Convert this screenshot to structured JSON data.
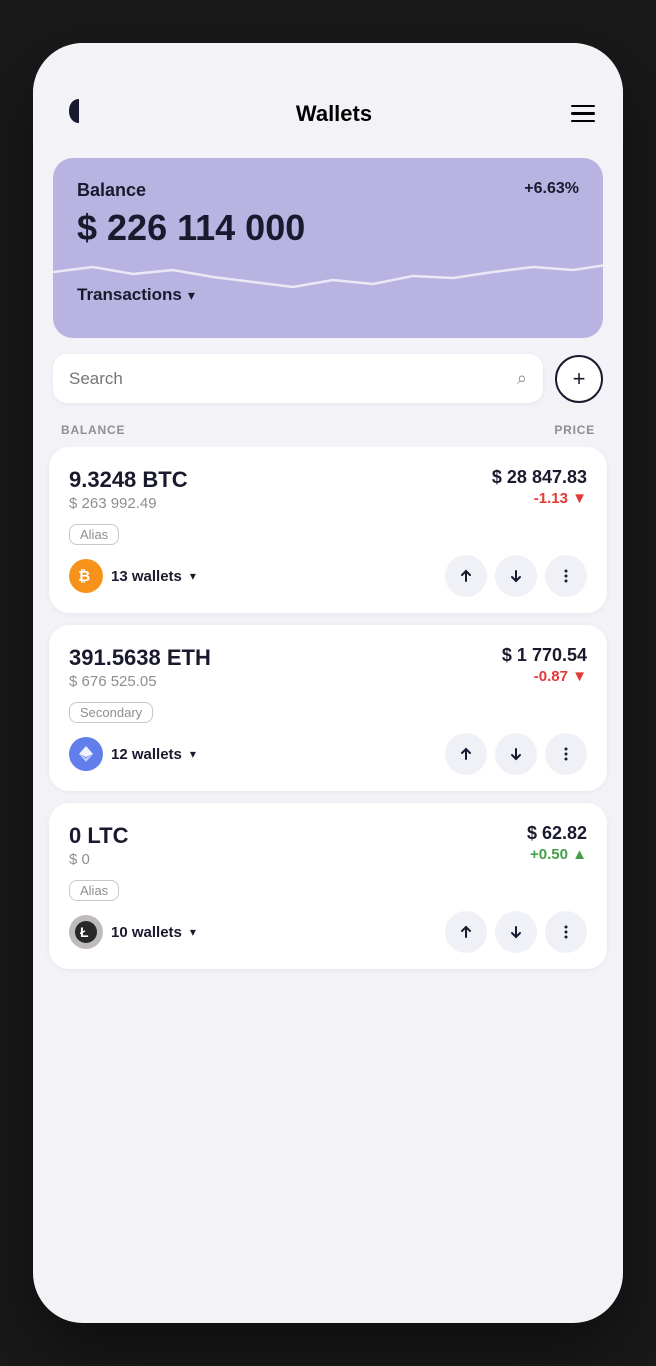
{
  "header": {
    "title": "Wallets",
    "menu_label": "menu",
    "logo_label": "logo"
  },
  "balance_card": {
    "label": "Balance",
    "change": "+6.63%",
    "amount": "$ 226 114 000",
    "transactions_label": "Transactions"
  },
  "search": {
    "placeholder": "Search",
    "add_button_label": "+"
  },
  "columns": {
    "balance": "BALANCE",
    "price": "PRICE"
  },
  "assets": [
    {
      "id": "btc",
      "amount": "9.3248 BTC",
      "fiat_value": "$ 263 992.49",
      "price": "$ 28 847.83",
      "price_change": "-1.13 ▼",
      "price_change_type": "negative",
      "tag": "Alias",
      "wallets": "13 wallets",
      "coin_symbol": "₿",
      "coin_class": "btc"
    },
    {
      "id": "eth",
      "amount": "391.5638 ETH",
      "fiat_value": "$ 676 525.05",
      "price": "$ 1 770.54",
      "price_change": "-0.87 ▼",
      "price_change_type": "negative",
      "tag": "Secondary",
      "wallets": "12 wallets",
      "coin_symbol": "⬡",
      "coin_class": "eth"
    },
    {
      "id": "ltc",
      "amount": "0 LTC",
      "fiat_value": "$ 0",
      "price": "$ 62.82",
      "price_change": "+0.50 ▲",
      "price_change_type": "positive",
      "tag": "Alias",
      "wallets": "10 wallets",
      "coin_symbol": "Ł",
      "coin_class": "ltc"
    }
  ],
  "icons": {
    "search": "🔍",
    "send": "↑",
    "receive": "↓",
    "more": "•••",
    "chevron": "∨"
  }
}
